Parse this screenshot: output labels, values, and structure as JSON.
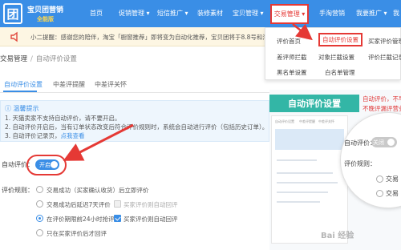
{
  "nav": {
    "logo_char": "团",
    "brand": "宝贝团营销",
    "edition": "全能版",
    "items": [
      "首页",
      "促销管理 ▾",
      "短信推广 ▾",
      "装修素材",
      "宝贝管理 ▾",
      "交易管理 ▾",
      "手淘营销",
      "我要推广 ▾",
      "我"
    ]
  },
  "notice": {
    "prefix": "小二提醒：感谢您的陪伴，淘宝「橱窗推荐」即将变为自动化推荐，宝贝团将于8.8号和淘"
  },
  "breadcrumb": {
    "root": "交易管理",
    "separator": "/",
    "current": "自动评价设置"
  },
  "tabs": [
    "自动评价设置",
    "中差评提醒",
    "中差评关怀"
  ],
  "tips": {
    "heading": "温馨提示",
    "lines": [
      "1. 天猫卖家不支持自动评价，请不要开启。",
      "2. 自动评价开启后，当有订单状态改变后符合评价规则时，系统会自动进行评价（包括历史订单）。",
      "3. 自动评价记录页，"
    ],
    "link": "点我查看"
  },
  "auto_review": {
    "label": "自动评价：",
    "toggle_text": "开启",
    "enabled": true
  },
  "rules": {
    "label": "评价规则：",
    "options": [
      {
        "text": "交易成功（买家确认收货）后立即评价",
        "selected": false
      },
      {
        "text": "交易成功后延迟7天评价",
        "selected": false,
        "checkbox": "买家评价则自动回评",
        "checkbox_checked": false
      },
      {
        "text": "在评价期限前24小时抢评",
        "selected": true,
        "checkbox": "买家评价则自动回评",
        "checkbox_checked": true
      },
      {
        "text": "只在买家评价后才回评",
        "selected": false
      }
    ]
  },
  "dropdown": {
    "items": [
      "评价首页",
      "自动评价设置",
      "买家评价管理",
      "差评师拦截",
      "对象拦截设置",
      "评价拦截记录",
      "黑名单设置",
      "白名单管理"
    ],
    "active": "自动评价设置"
  },
  "promo": {
    "title": "自动评价设置",
    "slogan_1": "自动评价，不早评晚",
    "slogan_2": "不晚评漏评营业",
    "mini_tabs": [
      "自动评价设置",
      "中差评提醒",
      "中差评关怀"
    ],
    "mag_label_1": "自动评价：",
    "mag_toggle": "关闭",
    "mag_label_2": "评价规则：",
    "mag_opt_1": "交易",
    "mag_opt_2": "交易"
  },
  "watermark": "Bai 经验",
  "colors": {
    "nav_blue": "#3a8ee6",
    "highlight_red": "#e53935",
    "promo_teal": "#33b6a6",
    "notice_bg": "#fdf6e3"
  }
}
